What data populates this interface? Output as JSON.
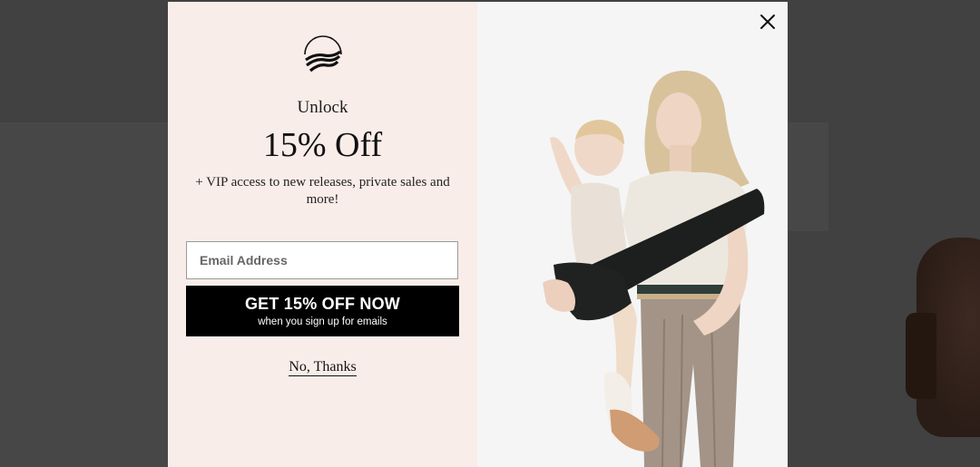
{
  "popup": {
    "logo_icon": "sunrise-fields-icon",
    "eyebrow": "Unlock",
    "headline": "15% Off",
    "subtext": "+ VIP access to new releases, private sales and more!",
    "email_placeholder": "Email Address",
    "email_value": "",
    "cta_main": "GET 15% OFF NOW",
    "cta_sub": "when you sign up for emails",
    "decline_label": "No, Thanks",
    "close_icon": "close-icon",
    "photo": "mother-holding-toddler-in-sling-carrier"
  },
  "colors": {
    "panel_bg": "#f9ede9",
    "cta_bg": "#000000",
    "cta_text": "#ffffff",
    "overlay": "#414141"
  }
}
